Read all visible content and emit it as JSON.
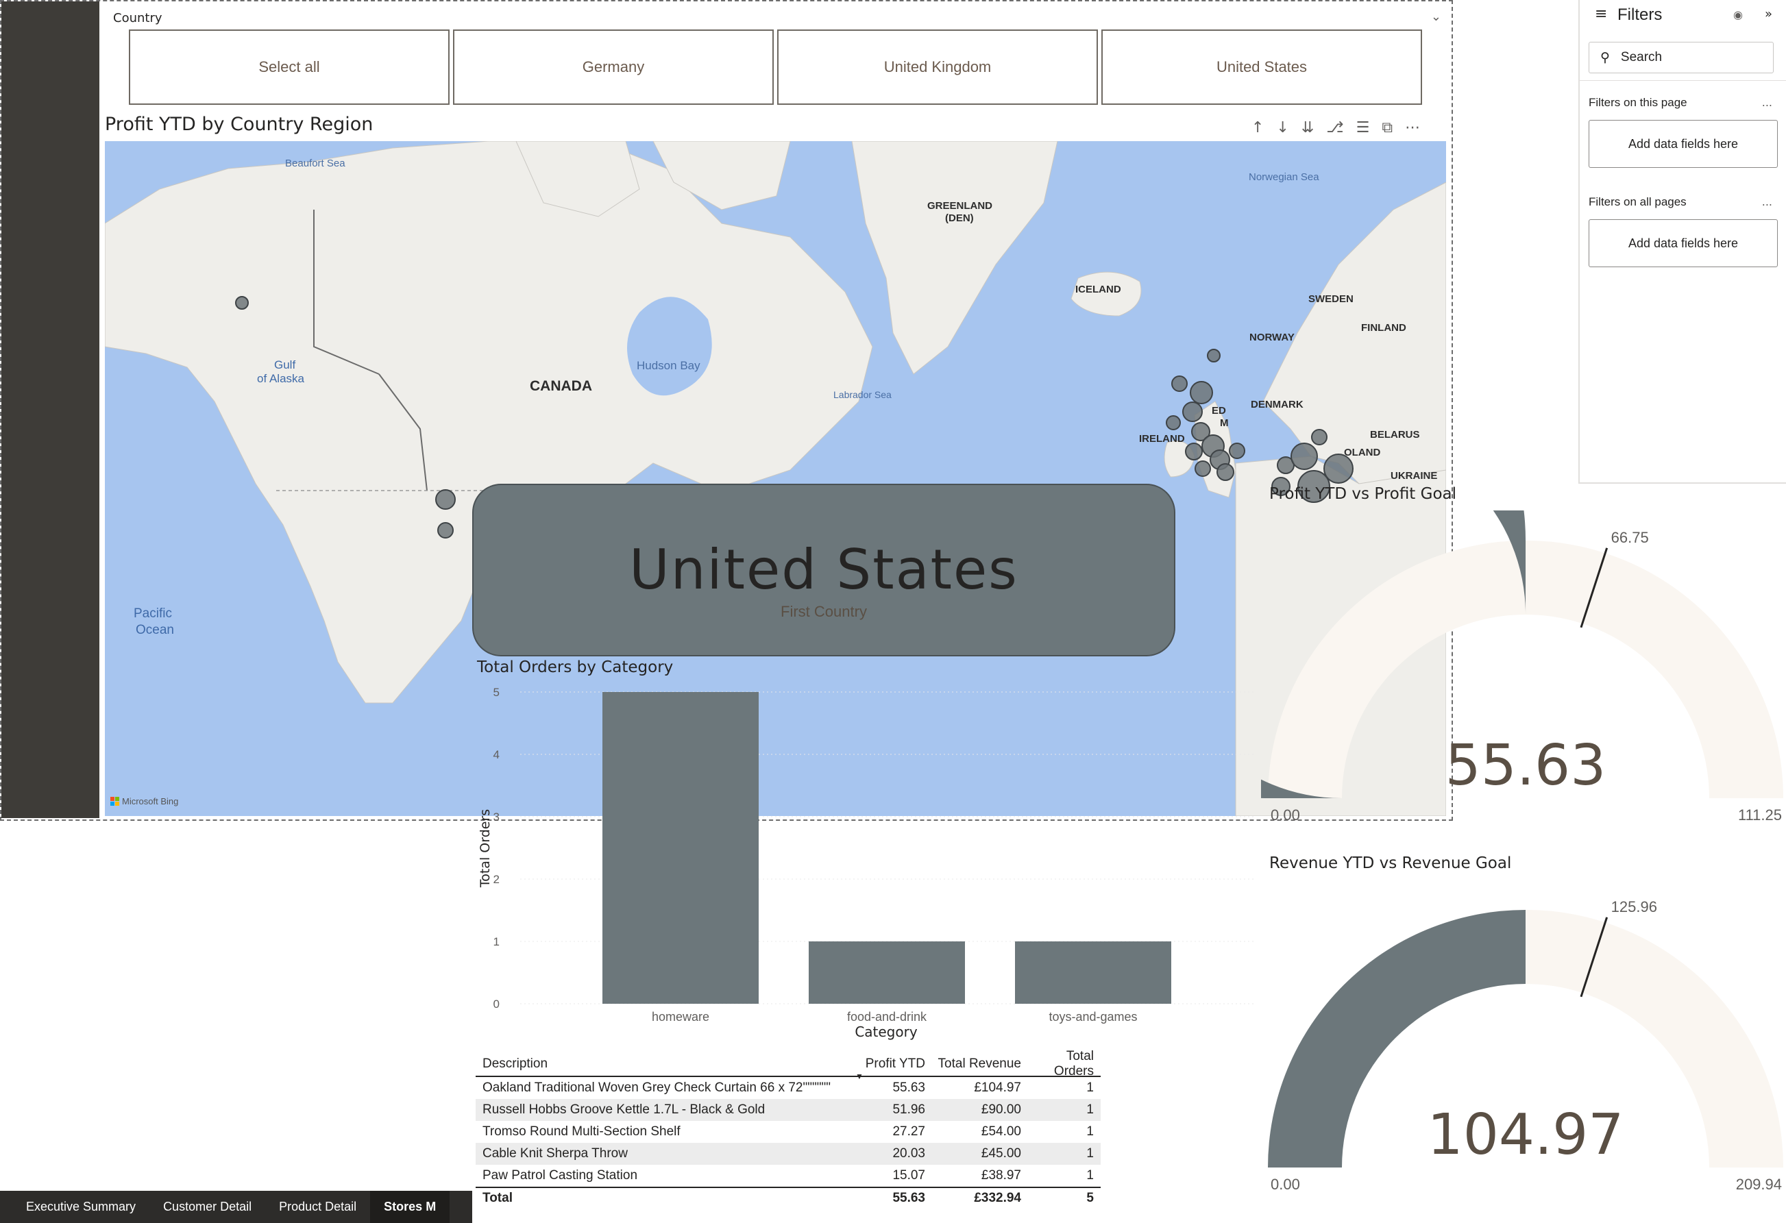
{
  "slicer": {
    "title": "Country",
    "options": [
      "Select all",
      "Germany",
      "United Kingdom",
      "United States"
    ]
  },
  "map": {
    "title": "Profit YTD by Country Region",
    "labels": {
      "beaufort": "Beaufort Sea",
      "norwegian": "Norwegian Sea",
      "greenland": "GREENLAND",
      "greenland_den": "(DEN)",
      "iceland": "ICELAND",
      "sweden": "SWEDEN",
      "finland": "FINLAND",
      "norway": "NORWAY",
      "denmark": "DENMARK",
      "ireland": "IRELAND",
      "belarus": "BELARUS",
      "poland": "OLAND",
      "ukraine": "UKRAINE",
      "canada": "CANADA",
      "hudson": "Hudson Bay",
      "labrador": "Labrador Sea",
      "gulf1": "Gulf",
      "gulf2": "of Alaska",
      "pacific1": "Pacific",
      "pacific2": "Ocean",
      "uk_fragment1": "ED",
      "uk_fragment2": "M"
    },
    "attribution": "Microsoft Bing"
  },
  "filters": {
    "title": "Filters",
    "search_placeholder": "Search",
    "on_page_label": "Filters on this page",
    "on_all_label": "Filters on all pages",
    "add_fields": "Add data fields here",
    "dots": "..."
  },
  "card": {
    "value": "United States",
    "label": "First Country"
  },
  "chart_data": [
    {
      "type": "bar",
      "title": "Total Orders by Category",
      "categories": [
        "homeware",
        "food-and-drink",
        "toys-and-games"
      ],
      "values": [
        5,
        1,
        1
      ],
      "xlabel": "Category",
      "ylabel": "Total Orders",
      "ylim": [
        0,
        5
      ],
      "yticks": [
        "0",
        "1",
        "2",
        "3",
        "4",
        "5"
      ],
      "grid": true,
      "bar_color": "#6c777b"
    },
    {
      "type": "gauge",
      "title": "Profit YTD vs Profit Goal",
      "value": 55.63,
      "value_label": "55.63",
      "min": 0,
      "min_label": "0.00",
      "max": 111.25,
      "max_label": "111.25",
      "target": 66.75,
      "target_label": "66.75",
      "fill_color": "#6c777b",
      "track_color": "#faf6f1"
    },
    {
      "type": "gauge",
      "title": "Revenue YTD vs Revenue Goal",
      "value": 104.97,
      "value_label": "104.97",
      "min": 0,
      "min_label": "0.00",
      "max": 209.94,
      "max_label": "209.94",
      "target": 125.96,
      "target_label": "125.96",
      "fill_color": "#6c777b",
      "track_color": "#faf6f1"
    }
  ],
  "table": {
    "headers": [
      "Description",
      "Profit YTD",
      "Total Revenue",
      "Total Orders"
    ],
    "rows": [
      [
        "Oakland Traditional Woven Grey Check Curtain 66 x 72\"\"\"\"\"\"",
        "55.63",
        "£104.97",
        "1"
      ],
      [
        "Russell Hobbs Groove Kettle 1.7L - Black & Gold",
        "51.96",
        "£90.00",
        "1"
      ],
      [
        "Tromso Round Multi-Section Shelf",
        "27.27",
        "£54.00",
        "1"
      ],
      [
        "Cable Knit Sherpa Throw",
        "20.03",
        "£45.00",
        "1"
      ],
      [
        "Paw Patrol Casting Station",
        "15.07",
        "£38.97",
        "1"
      ]
    ],
    "total": [
      "Total",
      "55.63",
      "£332.94",
      "5"
    ]
  },
  "tabs": [
    "Executive Summary",
    "Customer Detail",
    "Product Detail",
    "Stores M"
  ]
}
